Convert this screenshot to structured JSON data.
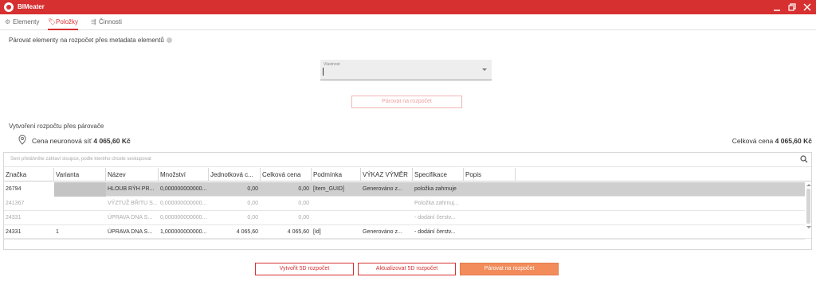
{
  "window": {
    "title": "BIMeater"
  },
  "tabs": [
    {
      "label": "Elementy",
      "icon": "elements-icon"
    },
    {
      "label": "Položky",
      "icon": "items-tag-icon"
    },
    {
      "label": "Činnosti",
      "icon": "activities-icon"
    }
  ],
  "metadata_section": {
    "title": "Párovat elementy na rozpočet přes metadata elementů",
    "property_select": {
      "label": "Vlastnost",
      "value": ""
    },
    "pair_button": "Párovat na rozpočet"
  },
  "budget_section": {
    "title": "Vytvoření rozpočtu přes párovače",
    "neural_price_label": "Cena neuronová síť",
    "neural_price_value": "4 065,60 Kč",
    "total_price_label": "Celková cena",
    "total_price_value": "4 065,60 Kč"
  },
  "grid": {
    "group_hint": "Sem přetáhněte záhlaví sloupce, podle kterého chcete seskupovat",
    "columns": [
      "Značka",
      "Varianta",
      "Název",
      "Množství",
      "Jednotková c...",
      "Celková cena",
      "Podmínka",
      "VÝKAZ VÝMĚR",
      "Specifikace",
      "Popis"
    ],
    "rows": [
      {
        "znacka": "26794",
        "varianta": "",
        "nazev": "HLOUB RÝH PR...",
        "mnozstvi": "0,000000000000...",
        "jednotkova": "0,00",
        "celkova": "0,00",
        "podminka": "[Item_GUID]",
        "vykaz": "Generováno z...",
        "specifikace": "položka zahrnuje",
        "popis": "",
        "state": "selected"
      },
      {
        "znacka": "241367",
        "varianta": "",
        "nazev": "VÝZTUŽ BŘITU S...",
        "mnozstvi": "0,000000000000...",
        "jednotkova": "0,00",
        "celkova": "0,00",
        "podminka": "",
        "vykaz": "",
        "specifikace": "Položka zahrnuj...",
        "popis": "",
        "state": "dim"
      },
      {
        "znacka": "24331",
        "varianta": "",
        "nazev": "ÚPRAVA DNA S...",
        "mnozstvi": "0,000000000000...",
        "jednotkova": "0,00",
        "celkova": "0,00",
        "podminka": "",
        "vykaz": "",
        "specifikace": "- dodání  čerstv...",
        "popis": "",
        "state": "dim"
      },
      {
        "znacka": "24331",
        "varianta": "1",
        "nazev": "ÚPRAVA DNA S...",
        "mnozstvi": "1,000000000000...",
        "jednotkova": "4 065,60",
        "celkova": "4 065,60",
        "podminka": "[Id]",
        "vykaz": "Generováno z...",
        "specifikace": "- dodání  čerstv...",
        "popis": "",
        "state": "normal"
      }
    ]
  },
  "footer_buttons": {
    "create": "Vytvořit 5D rozpočet",
    "update": "Aktualizovat 5D rozpočet",
    "pair": "Párovat na rozpočet"
  },
  "colors": {
    "accent": "#d63031",
    "pair_button": "#f28c5b",
    "selected_row": "#cfcfcf"
  }
}
